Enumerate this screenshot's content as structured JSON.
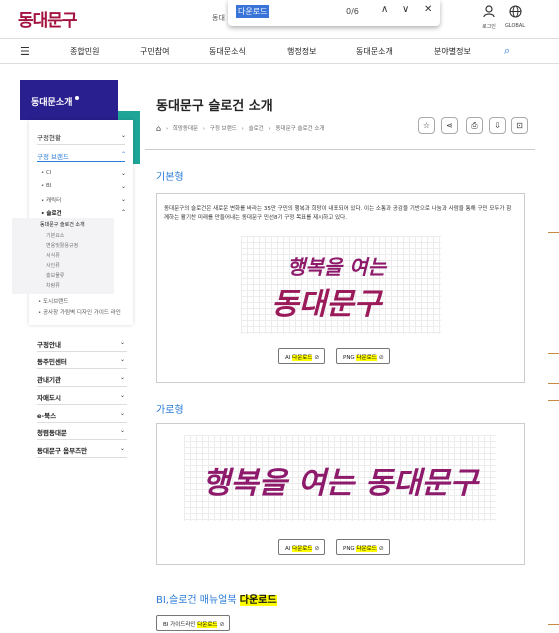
{
  "header": {
    "logo": "동대문구",
    "search_partial": "동대",
    "login_label": "로그인",
    "global_label": "GLOBAL"
  },
  "findbar": {
    "query": "다운로드",
    "count": "0/6",
    "up": "∧",
    "down": "∨",
    "close": "✕"
  },
  "nav": {
    "menu_icon": "hamburger-icon",
    "items": [
      "종합민원",
      "구민참여",
      "동대문소식",
      "행정정보",
      "동대문소개",
      "분야별정보"
    ]
  },
  "sidebar": {
    "title": "동대문소개",
    "items": [
      {
        "label": "구정현황",
        "chev": "⌄"
      },
      {
        "label": "구정 브랜드",
        "chev": "⌃"
      }
    ],
    "brand_sub": [
      {
        "label": "• CI",
        "chev": "⌄"
      },
      {
        "label": "• BI",
        "chev": "⌄"
      },
      {
        "label": "• 캐릭터",
        "chev": "⌄"
      },
      {
        "label": "• 슬로건",
        "chev": "⌃"
      }
    ],
    "slogan_sub": [
      "동대문구 슬로건 소개",
      "기본요소",
      "변용및활용규정",
      "서식류",
      "사인류",
      "홍보물류",
      "차량류"
    ],
    "brand_extra": [
      "• 도시브랜드",
      "• 공사장 가림벽 디자인 가이드 라인"
    ],
    "main_items": [
      "구정안내",
      "동주민센터",
      "관내기관",
      "자매도시",
      "e-북스",
      "청렴동대문",
      "동대문구 옴부즈만"
    ]
  },
  "content": {
    "title": "동대문구 슬로건 소개",
    "breadcrumb": [
      "희망동대문",
      "구정 브랜드",
      "슬로건",
      "동대문구 슬로건 소개"
    ],
    "basic_title": "기본형",
    "basic_desc": "동대문구의 슬로건은 새로운 변화를 바라는 35만 구민의 행복과 희망이 내포되어 있다. 이는 소통과 공감을 기반으로 나눔과 사람을 통해 구민 모두가 함께하는 활기찬 미래를 만들어내는 동대문구 민선8기 구정 목표를 제시하고 있다.",
    "slogan_line1": "행복을 여는",
    "slogan_line2": "동대문구",
    "slogan_horizontal": "행복을 여는 동대문구",
    "ai_prefix": "AI",
    "png_prefix": "PNG",
    "download": "다운로드",
    "horizontal_title": "가로형",
    "bi_title_prefix": "BI,슬로건 매뉴얼북",
    "bi_btn_prefix": "BI 가이드라인"
  },
  "colors": {
    "brand": "#a3123f",
    "accent": "#2a7bd6",
    "side_head": "#2a1f8f",
    "teal": "#1fa598",
    "highlight": "#ffff00"
  }
}
